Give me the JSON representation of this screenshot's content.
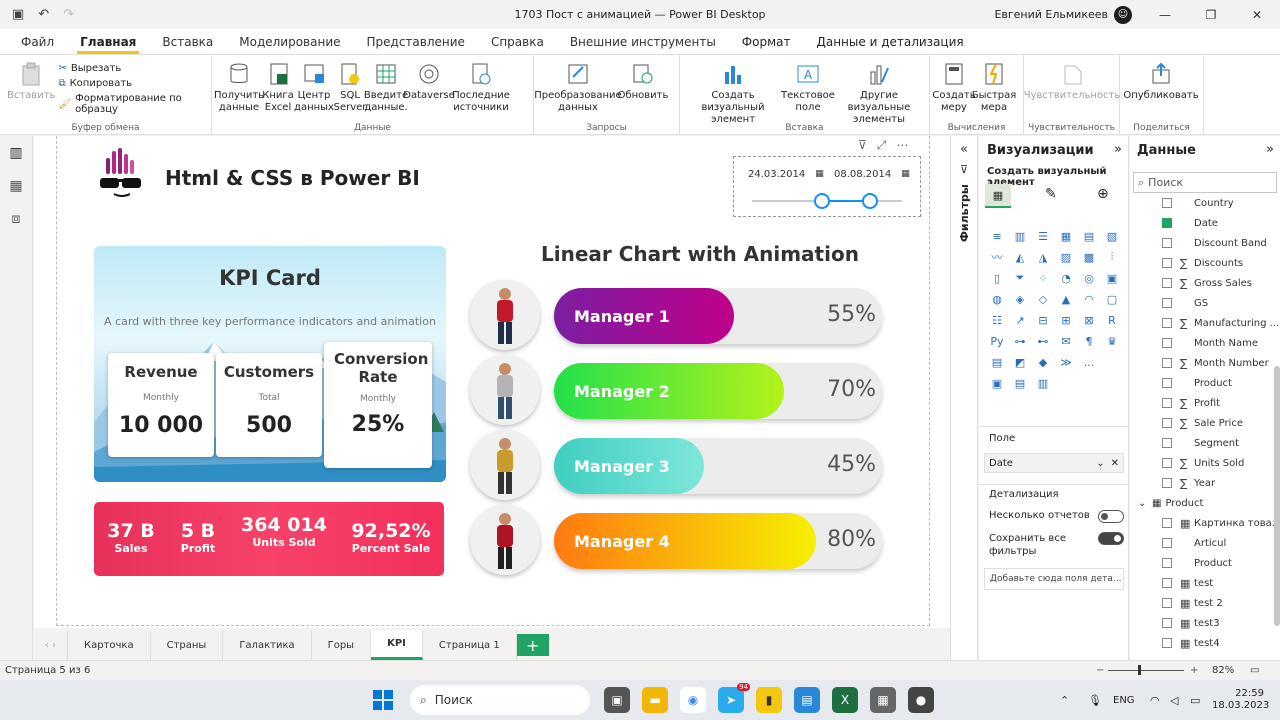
{
  "window": {
    "title": "1703 Пост с анимацией — Power BI Desktop",
    "user": "Евгений Ельмикеев"
  },
  "menu_tabs": [
    "Файл",
    "Главная",
    "Вставка",
    "Моделирование",
    "Представление",
    "Справка",
    "Внешние инструменты",
    "Формат",
    "Данные и детализация"
  ],
  "ribbon": {
    "paste": "Вставить",
    "cut": "Вырезать",
    "copy": "Копировать",
    "format_painter": "Форматирование по образцу",
    "clipboard_group": "Буфер обмена",
    "get_data": "Получить данные",
    "excel": "Книга Excel",
    "data_hub": "Центр данных",
    "sql": "SQL Server",
    "enter_data": "Введите данные.",
    "dataverse": "Dataverse",
    "recent": "Последние источники",
    "data_group": "Данные",
    "transform": "Преобразование данных",
    "refresh": "Обновить",
    "queries_group": "Запросы",
    "new_visual": "Создать визуальный элемент",
    "text_box": "Текстовое поле",
    "more_visuals": "Другие визуальные элементы",
    "insert_group": "Вставка",
    "new_measure": "Создать меру",
    "quick_measure": "Быстрая мера",
    "calc_group": "Вычисления",
    "sensitivity": "Чувствительность",
    "sensitivity_group": "Чувствительность",
    "publish": "Опубликовать",
    "share_group": "Поделиться"
  },
  "report": {
    "title": "Html & CSS в Power BI",
    "slicer": {
      "from": "24.03.2014",
      "to": "08.08.2014"
    },
    "kpi_card": {
      "title": "KPI Card",
      "subtitle": "A card with three key performance indicators and animation",
      "boxes": [
        {
          "head": "Revenue",
          "period": "Monthly",
          "value": "10 000"
        },
        {
          "head": "Customers",
          "period": "Total",
          "value": "500"
        },
        {
          "head": "Conversion Rate",
          "period": "Monthly",
          "value": "25%"
        }
      ]
    },
    "strip": [
      {
        "value": "37 B",
        "label": "Sales"
      },
      {
        "value": "5 B",
        "label": "Profit"
      },
      {
        "value": "364 014",
        "label": "Units Sold"
      },
      {
        "value": "92,52%",
        "label": "Percent Sale"
      }
    ],
    "linear_chart": {
      "title": "Linear Chart with Animation",
      "rows": [
        {
          "name": "Manager 1",
          "pct": "55%",
          "value": 55,
          "c1": "#7b1fa2",
          "c2": "#c0008a"
        },
        {
          "name": "Manager 2",
          "pct": "70%",
          "value": 70,
          "c1": "#22e04a",
          "c2": "#b4f21a"
        },
        {
          "name": "Manager 3",
          "pct": "45%",
          "value": 45,
          "c1": "#3fcfc0",
          "c2": "#7ee6da"
        },
        {
          "name": "Manager 4",
          "pct": "80%",
          "value": 80,
          "c1": "#ff7a12",
          "c2": "#f6f000"
        }
      ]
    }
  },
  "filters_label": "Фильтры",
  "viz_pane": {
    "title": "Визуализации",
    "subtitle": "Создать визуальный элемент",
    "field_label": "Поле",
    "field_value": "Date",
    "drill_label": "Детализация",
    "multi_reports": "Несколько отчетов",
    "keep_filters": "Сохранить все фильтры",
    "drop_hint": "Добавьте сюда поля дета..."
  },
  "data_pane": {
    "title": "Данные",
    "search_placeholder": "Поиск",
    "fields": [
      {
        "name": "Country",
        "sigma": false,
        "checked": false
      },
      {
        "name": "Date",
        "sigma": false,
        "checked": true
      },
      {
        "name": "Discount Band",
        "sigma": false,
        "checked": false
      },
      {
        "name": "Discounts",
        "sigma": true,
        "checked": false
      },
      {
        "name": "Gross Sales",
        "sigma": true,
        "checked": false
      },
      {
        "name": "GS",
        "sigma": false,
        "checked": false
      },
      {
        "name": "Manufacturing ...",
        "sigma": true,
        "checked": false
      },
      {
        "name": "Month Name",
        "sigma": false,
        "checked": false
      },
      {
        "name": "Month Number",
        "sigma": true,
        "checked": false
      },
      {
        "name": "Product",
        "sigma": false,
        "checked": false
      },
      {
        "name": "Profit",
        "sigma": true,
        "checked": false
      },
      {
        "name": "Sale Price",
        "sigma": true,
        "checked": false
      },
      {
        "name": "Segment",
        "sigma": false,
        "checked": false
      },
      {
        "name": "Units Sold",
        "sigma": true,
        "checked": false
      },
      {
        "name": "Year",
        "sigma": true,
        "checked": false
      }
    ],
    "table2": "Product",
    "fields2": [
      "Картинка товa...",
      "Articul",
      "Product",
      "test",
      "test 2",
      "test3",
      "test4"
    ]
  },
  "page_tabs": [
    "Карточка",
    "Страны",
    "Галактика",
    "Горы",
    "KPI",
    "Страница 1"
  ],
  "active_tab": "KPI",
  "status": {
    "page": "Страница 5 из 6",
    "zoom": "82%"
  },
  "taskbar": {
    "search": "Поиск",
    "lang": "ENG",
    "time": "22:59",
    "date": "18.03.2023",
    "badge": "94"
  }
}
